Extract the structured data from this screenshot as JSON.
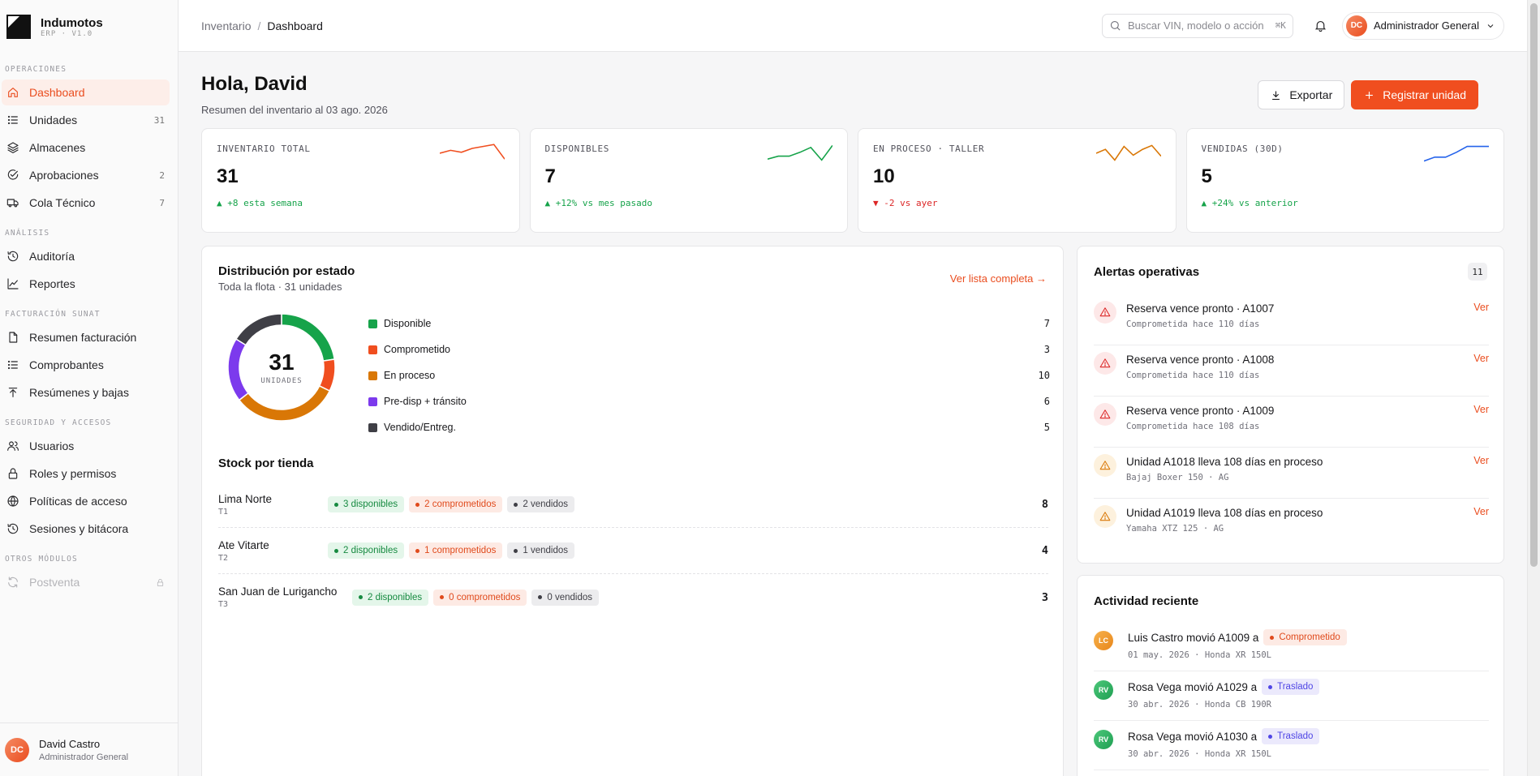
{
  "brand": {
    "name": "Indumotos",
    "version": "ERP · V1.0"
  },
  "sidebar": {
    "sections": [
      {
        "title": "OPERACIONES",
        "items": [
          {
            "label": "Dashboard",
            "icon": "home-icon",
            "count": "",
            "active": true
          },
          {
            "label": "Unidades",
            "icon": "list-icon",
            "count": "31"
          },
          {
            "label": "Almacenes",
            "icon": "layers-icon",
            "count": ""
          },
          {
            "label": "Aprobaciones",
            "icon": "check-circle-icon",
            "count": "2"
          },
          {
            "label": "Cola Técnico",
            "icon": "truck-icon",
            "count": "7"
          }
        ]
      },
      {
        "title": "ANÁLISIS",
        "items": [
          {
            "label": "Auditoría",
            "icon": "history-icon",
            "count": ""
          },
          {
            "label": "Reportes",
            "icon": "chart-line-icon",
            "count": ""
          }
        ]
      },
      {
        "title": "FACTURACIÓN SUNAT",
        "items": [
          {
            "label": "Resumen facturación",
            "icon": "file-icon",
            "count": ""
          },
          {
            "label": "Comprobantes",
            "icon": "list-icon",
            "count": ""
          },
          {
            "label": "Resúmenes y bajas",
            "icon": "upload-icon",
            "count": ""
          }
        ]
      },
      {
        "title": "SEGURIDAD Y ACCESOS",
        "items": [
          {
            "label": "Usuarios",
            "icon": "users-icon",
            "count": ""
          },
          {
            "label": "Roles y permisos",
            "icon": "lock-icon",
            "count": ""
          },
          {
            "label": "Políticas de acceso",
            "icon": "globe-icon",
            "count": ""
          },
          {
            "label": "Sesiones y bitácora",
            "icon": "history-icon",
            "count": ""
          }
        ]
      },
      {
        "title": "OTROS MÓDULOS",
        "items": [
          {
            "label": "Postventa",
            "icon": "refresh-icon",
            "count": "",
            "disabled": true
          }
        ]
      }
    ]
  },
  "user": {
    "initials": "DC",
    "name": "David Castro",
    "role": "Administrador General"
  },
  "topbar": {
    "breadcrumb": [
      "Inventario",
      "Dashboard"
    ],
    "search_placeholder": "Buscar VIN, modelo o acción",
    "search_kbd": "⌘K",
    "account_initials": "DC",
    "account_name": "Administrador General"
  },
  "greeting": {
    "title": "Hola, David",
    "subtitle": "Resumen del inventario al 03 ago. 2026"
  },
  "actions": {
    "export_label": "Exportar",
    "register_label": "Registrar unidad"
  },
  "colors": {
    "accent": "#f04e1f",
    "green": "#16a34a",
    "red": "#f04e1f",
    "orange": "#d97706",
    "purple": "#7c3aed",
    "gray": "#52525b",
    "blue": "#2563eb"
  },
  "kpis": [
    {
      "label": "INVENTARIO TOTAL",
      "value": "31",
      "delta": "▲ +8 esta semana",
      "delta_color": "#16a34a",
      "spark_color": "#f04e1f",
      "spark": [
        10,
        13,
        11,
        15,
        17,
        19,
        4
      ]
    },
    {
      "label": "DISPONIBLES",
      "value": "7",
      "delta": "▲ +12% vs mes pasado",
      "delta_color": "#16a34a",
      "spark_color": "#16a34a",
      "spark": [
        4,
        7,
        7,
        11,
        16,
        3,
        18
      ]
    },
    {
      "label": "EN PROCESO · TALLER",
      "value": "10",
      "delta": "▼ -2 vs ayer",
      "delta_color": "#dc2626",
      "spark_color": "#d97706",
      "spark": [
        10,
        14,
        3,
        17,
        8,
        14,
        18,
        7
      ]
    },
    {
      "label": "VENDIDAS (30D)",
      "value": "5",
      "delta": "▲ +24% vs anterior",
      "delta_color": "#16a34a",
      "spark_color": "#2563eb",
      "spark": [
        2,
        6,
        6,
        11,
        17,
        17,
        17
      ]
    }
  ],
  "distribution": {
    "title": "Distribución por estado",
    "subtitle": "Toda la flota · 31 unidades",
    "link": "Ver lista completa →",
    "total": "31",
    "unit_label": "UNIDADES"
  },
  "chart_data": {
    "type": "pie",
    "categories": [
      "Disponible",
      "Comprometido",
      "En proceso",
      "Pre-disp + tránsito",
      "Vendido/Entreg."
    ],
    "values": [
      7,
      3,
      10,
      6,
      5
    ],
    "colors": [
      "#16a34a",
      "#f04e1f",
      "#d97706",
      "#7c3aed",
      "#3f3f46"
    ]
  },
  "stock": {
    "title": "Stock por tienda",
    "stores": [
      {
        "name": "Lima Norte",
        "code": "T1",
        "available": "3 disponibles",
        "committed": "2 comprometidos",
        "sold": "2 vendidos",
        "total": "8"
      },
      {
        "name": "Ate Vitarte",
        "code": "T2",
        "available": "2 disponibles",
        "committed": "1 comprometidos",
        "sold": "1 vendidos",
        "total": "4"
      },
      {
        "name": "San Juan de Lurigancho",
        "code": "T3",
        "available": "2 disponibles",
        "committed": "0 comprometidos",
        "sold": "0 vendidos",
        "total": "3"
      }
    ]
  },
  "alerts": {
    "title": "Alertas operativas",
    "count": "11",
    "items": [
      {
        "severity": "danger",
        "title": "Reserva vence pronto · A1007",
        "detail": "Comprometida hace 110 días",
        "link": "Ver"
      },
      {
        "severity": "danger",
        "title": "Reserva vence pronto · A1008",
        "detail": "Comprometida hace 110 días",
        "link": "Ver"
      },
      {
        "severity": "danger",
        "title": "Reserva vence pronto · A1009",
        "detail": "Comprometida hace 108 días",
        "link": "Ver"
      },
      {
        "severity": "warning",
        "title": "Unidad A1018 lleva 108 días en proceso",
        "detail": "Bajaj Boxer 150 · AG",
        "link": "Ver"
      },
      {
        "severity": "warning",
        "title": "Unidad A1019 lleva 108 días en proceso",
        "detail": "Yamaha XTZ 125 · AG",
        "link": "Ver"
      }
    ]
  },
  "activity": {
    "title": "Actividad reciente",
    "items": [
      {
        "initials": "LC",
        "avatar_color": "orange",
        "text": "Luis Castro movió A1009 a",
        "status": "Comprometido",
        "status_color": "red",
        "detail": "01 may. 2026 · Honda XR 150L"
      },
      {
        "initials": "RV",
        "avatar_color": "green",
        "text": "Rosa Vega movió A1029 a",
        "status": "Traslado",
        "status_color": "purple",
        "detail": "30 abr. 2026 · Honda CB 190R"
      },
      {
        "initials": "RV",
        "avatar_color": "green",
        "text": "Rosa Vega movió A1030 a",
        "status": "Traslado",
        "status_color": "purple",
        "detail": "30 abr. 2026 · Honda XR 150L"
      }
    ]
  }
}
